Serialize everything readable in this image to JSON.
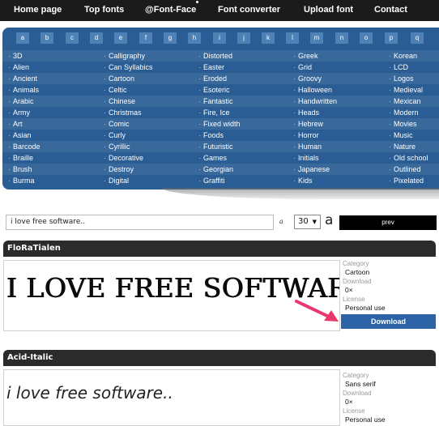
{
  "nav": [
    {
      "label": "Home page"
    },
    {
      "label": "Top fonts"
    },
    {
      "label": "@Font-Face"
    },
    {
      "label": "Font converter"
    },
    {
      "label": "Upload font"
    },
    {
      "label": "Contact"
    }
  ],
  "letters": [
    "a",
    "b",
    "c",
    "d",
    "e",
    "f",
    "g",
    "h",
    "i",
    "j",
    "k",
    "l",
    "m",
    "n",
    "o",
    "p",
    "q"
  ],
  "categories": [
    [
      "3D",
      "Alien",
      "Ancient",
      "Animals",
      "Arabic",
      "Army",
      "Art",
      "Asian",
      "Barcode",
      "Braille",
      "Brush",
      "Burma"
    ],
    [
      "Calligraphy",
      "Can Syllabics",
      "Cartoon",
      "Celtic",
      "Chinese",
      "Christmas",
      "Comic",
      "Curly",
      "Cyrillic",
      "Decorative",
      "Destroy",
      "Digital"
    ],
    [
      "Distorted",
      "Easter",
      "Eroded",
      "Esoteric",
      "Fantastic",
      "Fire, Ice",
      "Fixed width",
      "Foods",
      "Futuristic",
      "Games",
      "Georgian",
      "Graffiti"
    ],
    [
      "Greek",
      "Grid",
      "Groovy",
      "Halloween",
      "Handwritten",
      "Heads",
      "Hebrew",
      "Horror",
      "Human",
      "Initials",
      "Japanese",
      "Kids"
    ],
    [
      "Korean",
      "LCD",
      "Logos",
      "Medieval",
      "Mexican",
      "Modern",
      "Movies",
      "Music",
      "Nature",
      "Old school",
      "Outlined",
      "Pixelated"
    ]
  ],
  "controls": {
    "text_value": "i love free software..",
    "small_a": "a",
    "size_value": "30",
    "big_a": "a",
    "prev_label": "prev"
  },
  "fonts": [
    {
      "name": "FloRaTialen",
      "preview": "I LOVE FREE SOFTWARE",
      "category_label": "Category",
      "category": "Cartoon",
      "download_label": "Download",
      "downloads": "0×",
      "license_label": "License",
      "license": "Personal use",
      "button": "Download"
    },
    {
      "name": "Acid-Italic",
      "preview": "i love free software..",
      "category_label": "Category",
      "category": "Sans serif",
      "download_label": "Download",
      "downloads": "0×",
      "license_label": "License",
      "license": "Personal use"
    }
  ],
  "colors": {
    "nav_bg": "#1b1b1b",
    "panel_bg": "#2a5d93",
    "letter_bg": "#4e81b5",
    "download_bg": "#2b63a6",
    "arrow": "#e8386d"
  }
}
